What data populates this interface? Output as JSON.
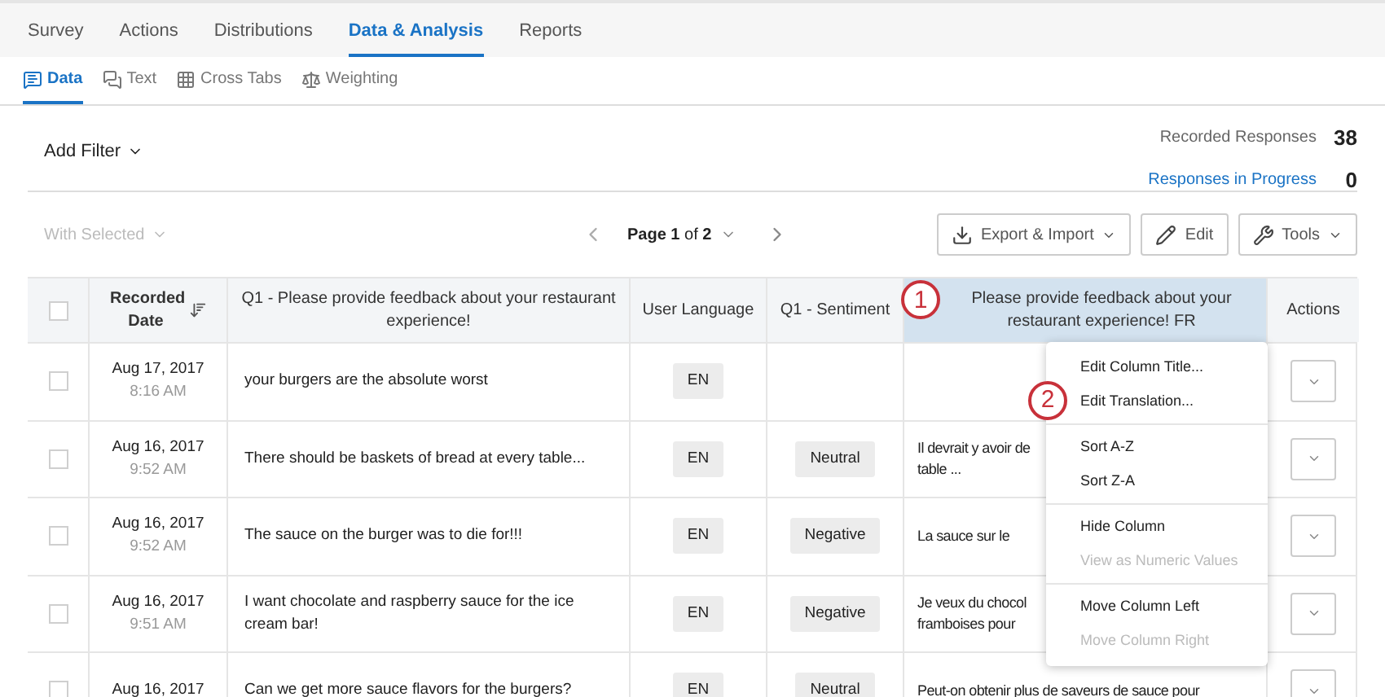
{
  "top_tabs": [
    {
      "label": "Survey",
      "selected": false
    },
    {
      "label": "Actions",
      "selected": false
    },
    {
      "label": "Distributions",
      "selected": false
    },
    {
      "label": "Data & Analysis",
      "selected": true
    },
    {
      "label": "Reports",
      "selected": false
    }
  ],
  "sub_tabs": [
    {
      "label": "Data",
      "selected": true,
      "kind": "data"
    },
    {
      "label": "Text",
      "selected": false,
      "kind": "text"
    },
    {
      "label": "Cross Tabs",
      "selected": false,
      "kind": "crosstabs"
    },
    {
      "label": "Weighting",
      "selected": false,
      "kind": "weighting"
    }
  ],
  "filter": {
    "label": "Add Filter"
  },
  "stats": [
    {
      "label": "Recorded Responses",
      "value": "38",
      "kind": "plain"
    },
    {
      "label": "Responses in Progress",
      "value": "0",
      "kind": "link"
    }
  ],
  "with_selected": {
    "label": "With Selected",
    "disabled": true
  },
  "pager": {
    "text": "**Page 1** of **2**"
  },
  "buttons": [
    {
      "label": "Export & Import",
      "kind": "export",
      "caret": true
    },
    {
      "label": "Edit",
      "kind": "edit",
      "caret": false
    },
    {
      "label": "Tools",
      "kind": "tools",
      "caret": true
    }
  ],
  "table": {
    "select_all": {
      "checked": false
    },
    "columns": [
      {
        "label": "Recorded Date",
        "highlighted": false,
        "kind": "date"
      },
      {
        "label": "Q1 - Please provide feedback about your restaurant experience!",
        "highlighted": false,
        "kind": "text"
      },
      {
        "label": "User Language",
        "highlighted": false,
        "kind": "text"
      },
      {
        "label": "Q1 - Sentiment",
        "highlighted": false,
        "kind": "text"
      },
      {
        "label": "Please provide feedback about your restaurant experience! FR",
        "highlighted": true,
        "kind": "text"
      },
      {
        "label": "Actions",
        "highlighted": false,
        "kind": "text"
      }
    ],
    "rows": [
      {
        "checked": false,
        "date": "Aug 17, 2017",
        "time": "8:16 AM",
        "response": "your burgers are the absolute worst",
        "language": "EN",
        "translation_lines": []
      },
      {
        "checked": false,
        "date": "Aug 16, 2017",
        "time": "9:52 AM",
        "response": "There should be baskets of bread at every table...",
        "language": "EN",
        "sentiment": "Neutral",
        "translation_lines": [
          "Il devrait y avoir de",
          "table ..."
        ]
      },
      {
        "checked": false,
        "date": "Aug 16, 2017",
        "time": "9:52 AM",
        "response": "The sauce on the burger was to die for!!!",
        "language": "EN",
        "sentiment": "Negative",
        "translation_lines": [
          "La sauce sur le"
        ]
      },
      {
        "checked": false,
        "date": "Aug 16, 2017",
        "time": "9:51 AM",
        "response": "I want chocolate and raspberry sauce for the ice cream bar!",
        "language": "EN",
        "sentiment": "Negative",
        "translation_lines": [
          "Je veux du chocol",
          "framboises pour"
        ]
      },
      {
        "checked": false,
        "date": "Aug 16, 2017",
        "response": "Can we get more sauce flavors for the burgers?",
        "language": "EN",
        "sentiment": "Neutral",
        "translation_lines": [
          "Peut-on obtenir plus de saveurs de sauce pour"
        ]
      }
    ]
  },
  "column_menu": [
    [
      {
        "label": "Edit Column Title...",
        "disabled": false
      },
      {
        "label": "Edit Translation...",
        "disabled": false
      }
    ],
    [
      {
        "label": "Sort A-Z",
        "disabled": false
      },
      {
        "label": "Sort Z-A",
        "disabled": false
      }
    ],
    [
      {
        "label": "Hide Column",
        "disabled": false
      },
      {
        "label": "View as Numeric Values",
        "disabled": true
      }
    ],
    [
      {
        "label": "Move Column Left",
        "disabled": false
      },
      {
        "label": "Move Column Right",
        "disabled": true
      }
    ]
  ],
  "callouts": [
    {
      "number": "1"
    },
    {
      "number": "2"
    }
  ]
}
